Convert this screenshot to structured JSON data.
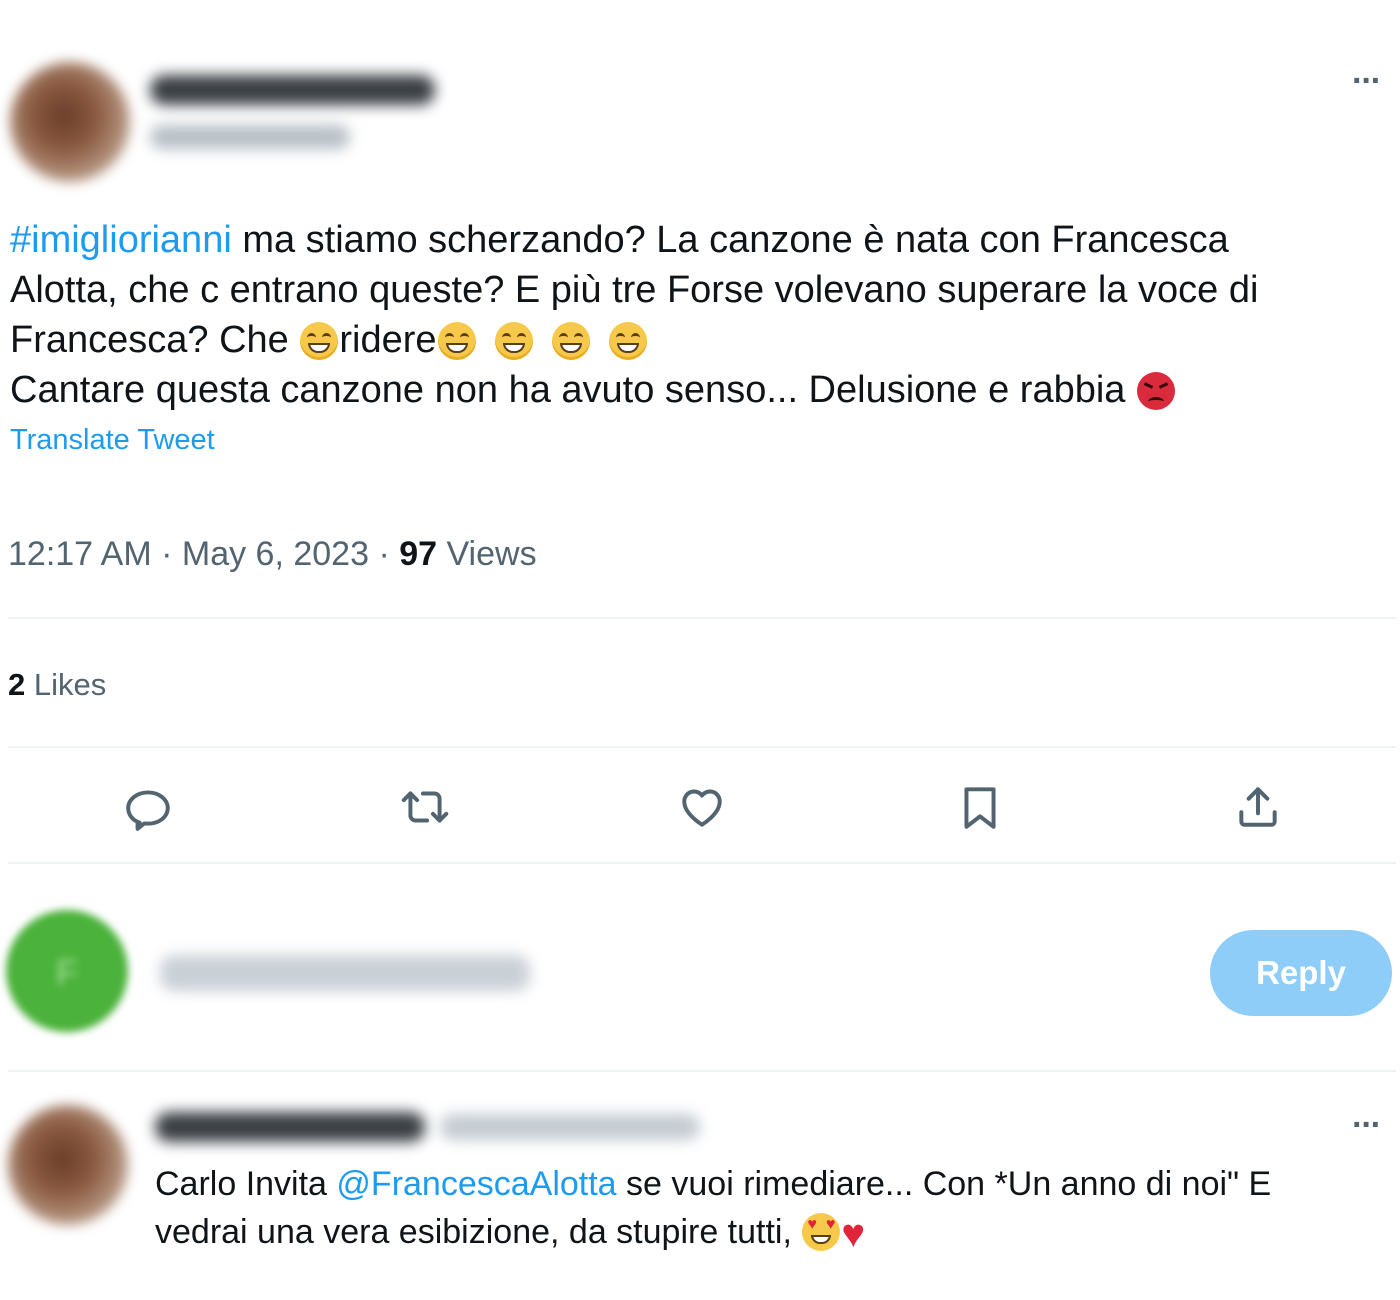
{
  "tweet": {
    "hashtag": "#imigliorianni",
    "line1_rest": " ma stiamo scherzando? La canzone è nata con Francesca",
    "line2": "Alotta, che c entrano queste? E più tre Forse volevano superare la voce di",
    "line3_a": "Francesca? Che ",
    "line3_b": "ridere",
    "line4": "Cantare questa canzone non ha avuto senso... Delusione e rabbia ",
    "translate_label": "Translate Tweet",
    "time": "12:17 AM",
    "date": "May 6, 2023",
    "separator": " · ",
    "views_count": "97",
    "views_label": " Views",
    "likes_count": "2",
    "likes_label": " Likes"
  },
  "actions": [
    {
      "name": "reply-icon"
    },
    {
      "name": "retweet-icon"
    },
    {
      "name": "like-icon"
    },
    {
      "name": "bookmark-icon"
    },
    {
      "name": "share-icon"
    }
  ],
  "composer": {
    "avatar_letter": "F",
    "button_label": "Reply",
    "button_color": "#8ecdf8"
  },
  "reply": {
    "text_a": "Carlo Invita ",
    "mention": "@FrancescaAlotta",
    "text_b": "  se vuoi rimediare... Con *Un anno di noi\" E",
    "text_c": "vedrai una vera esibizione, da stupire tutti, "
  },
  "colors": {
    "accent": "#1d9bf0",
    "text": "#0f1419",
    "secondary": "#536471",
    "divider": "#eff3f4"
  }
}
